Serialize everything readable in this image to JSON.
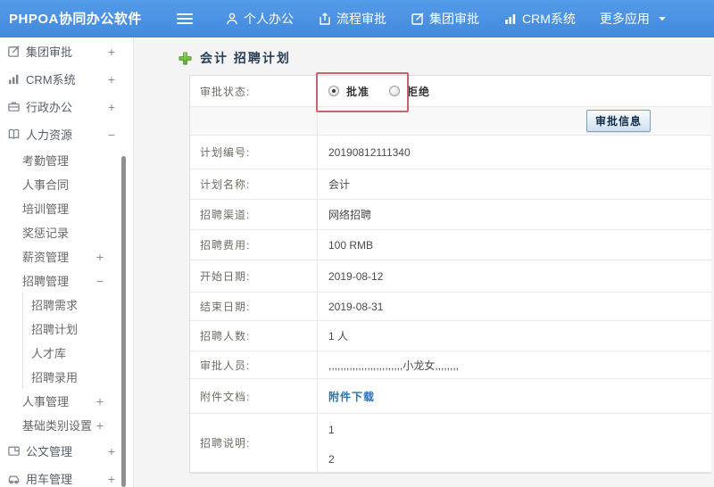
{
  "colors": {
    "topbar_blue": "#4a90e2",
    "annotation_red": "#c4646c",
    "link_blue": "#2a6fc0",
    "plus_green": "#5cb832"
  },
  "topbar": {
    "logo": "PHPOA协同办公软件",
    "menu": [
      {
        "name": "personal-office",
        "label": "个人办公",
        "icon": "user-icon"
      },
      {
        "name": "process-approval",
        "label": "流程审批",
        "icon": "process-icon"
      },
      {
        "name": "group-approval",
        "label": "集团审批",
        "icon": "edit-icon"
      },
      {
        "name": "crm-system",
        "label": "CRM系统",
        "icon": "chart-icon"
      },
      {
        "name": "more-apps",
        "label": "更多应用",
        "icon": "",
        "caret": "caret-down-icon"
      }
    ]
  },
  "sidebar": {
    "items": [
      {
        "name": "group-approval",
        "label": "集团审批",
        "level": 1,
        "icon": "edit-icon",
        "toggle": "+"
      },
      {
        "name": "crm-system",
        "label": "CRM系统",
        "level": 1,
        "icon": "chart-icon",
        "toggle": "+"
      },
      {
        "name": "admin-office",
        "label": "行政办公",
        "level": 1,
        "icon": "briefcase-icon",
        "toggle": "+"
      },
      {
        "name": "human-resources",
        "label": "人力资源",
        "level": 1,
        "icon": "book-icon",
        "toggle": "−"
      },
      {
        "name": "attendance-management",
        "label": "考勤管理",
        "level": 2,
        "toggle": ""
      },
      {
        "name": "personnel-contract",
        "label": "人事合同",
        "level": 2,
        "toggle": ""
      },
      {
        "name": "training-management",
        "label": "培训管理",
        "level": 2,
        "toggle": ""
      },
      {
        "name": "reward-punish-records",
        "label": "奖惩记录",
        "level": 2,
        "toggle": ""
      },
      {
        "name": "salary-management",
        "label": "薪资管理",
        "level": 2,
        "toggle": "+"
      },
      {
        "name": "recruitment-management",
        "label": "招聘管理",
        "level": 2,
        "toggle": "−"
      },
      {
        "name": "recruitment-demand",
        "label": "招聘需求",
        "level": 3,
        "toggle": ""
      },
      {
        "name": "recruitment-plan",
        "label": "招聘计划",
        "level": 3,
        "toggle": ""
      },
      {
        "name": "talent-pool",
        "label": "人才库",
        "level": 3,
        "toggle": ""
      },
      {
        "name": "recruitment-hiring",
        "label": "招聘录用",
        "level": 3,
        "toggle": ""
      },
      {
        "name": "personnel-management",
        "label": "人事管理",
        "level": 2,
        "toggle": "+"
      },
      {
        "name": "basic-category-settings",
        "label": "基础类别设置",
        "level": 2,
        "toggle": "+"
      },
      {
        "name": "document-management",
        "label": "公文管理",
        "level": 1,
        "icon": "document-icon",
        "toggle": "+"
      },
      {
        "name": "vehicle-management",
        "label": "用车管理",
        "level": 1,
        "icon": "car-icon",
        "toggle": "+"
      }
    ]
  },
  "main": {
    "title": "会计 招聘计划",
    "approval": {
      "label": "审批状态:",
      "options": [
        {
          "label": "批准",
          "selected": true
        },
        {
          "label": "拒绝",
          "selected": false
        }
      ],
      "button_label": "审批信息"
    },
    "fields": [
      {
        "name": "plan-number",
        "label": "计划编号:",
        "value": "20190812111340"
      },
      {
        "name": "plan-name",
        "label": "计划名称:",
        "value": "会计"
      },
      {
        "name": "recruitment-channel",
        "label": "招聘渠道:",
        "value": "网络招聘"
      },
      {
        "name": "recruitment-cost",
        "label": "招聘费用:",
        "value": "100 RMB"
      },
      {
        "name": "start-date",
        "label": "开始日期:",
        "value": "2019-08-12"
      },
      {
        "name": "end-date",
        "label": "结束日期:",
        "value": "2019-08-31"
      },
      {
        "name": "recruitment-headcount",
        "label": "招聘人数:",
        "value": "1 人"
      },
      {
        "name": "approval-personnel",
        "label": "审批人员:",
        "value": ",,,,,,,,,,,,,,,,,,,,,,,,,小龙女,,,,,,,,"
      },
      {
        "name": "attachment-document",
        "label": "附件文档:",
        "value": "附件下载",
        "type": "link"
      },
      {
        "name": "recruitment-description",
        "label": "招聘说明:",
        "value": [
          "1",
          "2"
        ],
        "type": "multiline"
      }
    ]
  }
}
